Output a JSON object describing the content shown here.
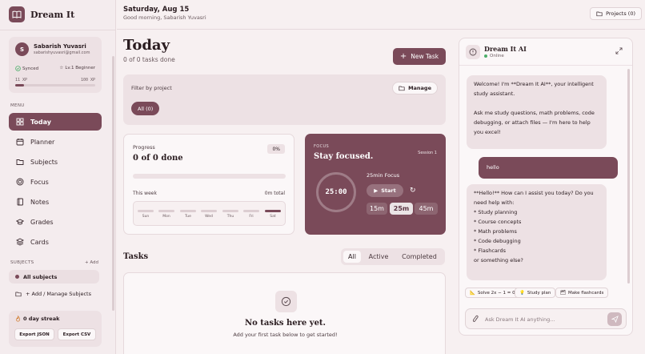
{
  "app": {
    "name": "Dream It"
  },
  "user": {
    "initial": "S",
    "name": "Sabarish Yuvasri",
    "email": "sabarishyuvasri@gmail.com",
    "sync_status": "Synced",
    "level": "Lv.1 Beginner",
    "xp_current": "11 XP",
    "xp_next": "100 XP",
    "xp_progress": 0.11
  },
  "sidebar": {
    "menu_label": "MENU",
    "items": [
      {
        "label": "Today",
        "icon": "grid-icon",
        "active": true
      },
      {
        "label": "Planner",
        "icon": "calendar-icon"
      },
      {
        "label": "Subjects",
        "icon": "folder-icon"
      },
      {
        "label": "Focus",
        "icon": "target-icon"
      },
      {
        "label": "Notes",
        "icon": "notebook-icon"
      },
      {
        "label": "Grades",
        "icon": "graduation-cap-icon"
      },
      {
        "label": "Cards",
        "icon": "layers-icon"
      }
    ],
    "subjects_label": "SUBJECTS",
    "subjects_add": "+ Add",
    "all_subjects": "All subjects",
    "manage_subjects": "+ Add / Manage Subjects",
    "streak": "0 day streak",
    "export_json": "Export JSON",
    "export_csv": "Export CSV"
  },
  "header": {
    "date": "Saturday, Aug 15",
    "greeting": "Good morning, Sabarish Yuvasri",
    "projects_button": "Projects (0)"
  },
  "main": {
    "title": "Today",
    "subtitle": "0 of 0 tasks done",
    "new_task": "New Task",
    "filter": {
      "label": "Filter by project",
      "manage": "Manage",
      "chip": "All (0)"
    },
    "progress": {
      "label": "Progress",
      "value": "0 of 0 done",
      "percent": "0%",
      "fraction": 0,
      "week_label": "This week",
      "week_total": "0m total",
      "days": [
        "Sun",
        "Mon",
        "Tue",
        "Wed",
        "Thu",
        "Fri",
        "Sat"
      ]
    },
    "focus": {
      "label": "FOCUS",
      "title": "Stay focused.",
      "session": "Session 1",
      "timer": "25:00",
      "mode": "25min Focus",
      "start": "Start",
      "durations": [
        "15m",
        "25m",
        "45m"
      ],
      "selected": "25m"
    },
    "tasks": {
      "title": "Tasks",
      "tabs": [
        "All",
        "Active",
        "Completed"
      ],
      "selected_tab": "All",
      "empty_title": "No tasks here yet.",
      "empty_sub": "Add your first task below to get started!"
    }
  },
  "ai": {
    "name": "Dream It AI",
    "status": "Online",
    "messages": [
      {
        "role": "ai",
        "text": "Welcome! I'm **Dream It AI**, your intelligent study assistant.\n\nAsk me study questions, math problems, code debugging, or attach files — I'm here to help you excel!"
      },
      {
        "role": "user",
        "text": "hello"
      },
      {
        "role": "ai",
        "text": "**Hello!** How can I assist you today? Do you need help with:\n* Study planning\n* Course concepts\n* Math problems\n* Code debugging\n* Flashcards\nor something else?"
      }
    ],
    "chips": [
      "Solve 2x − 1 = 0",
      "Study plan",
      "Make flashcards"
    ],
    "input_placeholder": "Ask Dream It AI anything..."
  }
}
